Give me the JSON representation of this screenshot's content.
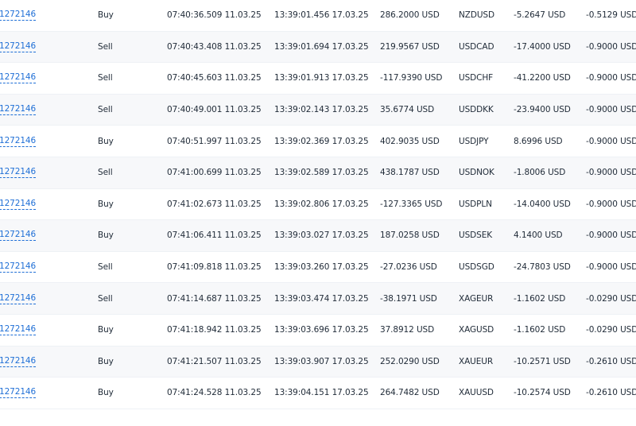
{
  "trades": [
    {
      "id": "1272146",
      "type": "Buy",
      "open_time": "07:40:36.509 11.03.25",
      "close_time": "13:39:01.456 17.03.25",
      "profit": "286.2000 USD",
      "symbol": "NZDUSD",
      "swap": "-5.2647 USD",
      "commission": "-0.5129 USD"
    },
    {
      "id": "1272146",
      "type": "Sell",
      "open_time": "07:40:43.408 11.03.25",
      "close_time": "13:39:01.694 17.03.25",
      "profit": "219.9567 USD",
      "symbol": "USDCAD",
      "swap": "-17.4000 USD",
      "commission": "-0.9000 USD"
    },
    {
      "id": "1272146",
      "type": "Sell",
      "open_time": "07:40:45.603 11.03.25",
      "close_time": "13:39:01.913 17.03.25",
      "profit": "-117.9390 USD",
      "symbol": "USDCHF",
      "swap": "-41.2200 USD",
      "commission": "-0.9000 USD"
    },
    {
      "id": "1272146",
      "type": "Sell",
      "open_time": "07:40:49.001 11.03.25",
      "close_time": "13:39:02.143 17.03.25",
      "profit": "35.6774 USD",
      "symbol": "USDDKK",
      "swap": "-23.9400 USD",
      "commission": "-0.9000 USD"
    },
    {
      "id": "1272146",
      "type": "Buy",
      "open_time": "07:40:51.997 11.03.25",
      "close_time": "13:39:02.369 17.03.25",
      "profit": "402.9035 USD",
      "symbol": "USDJPY",
      "swap": "8.6996 USD",
      "commission": "-0.9000 USD"
    },
    {
      "id": "1272146",
      "type": "Sell",
      "open_time": "07:41:00.699 11.03.25",
      "close_time": "13:39:02.589 17.03.25",
      "profit": "438.1787 USD",
      "symbol": "USDNOK",
      "swap": "-1.8006 USD",
      "commission": "-0.9000 USD"
    },
    {
      "id": "1272146",
      "type": "Buy",
      "open_time": "07:41:02.673 11.03.25",
      "close_time": "13:39:02.806 17.03.25",
      "profit": "-127.3365 USD",
      "symbol": "USDPLN",
      "swap": "-14.0400 USD",
      "commission": "-0.9000 USD"
    },
    {
      "id": "1272146",
      "type": "Buy",
      "open_time": "07:41:06.411 11.03.25",
      "close_time": "13:39:03.027 17.03.25",
      "profit": "187.0258 USD",
      "symbol": "USDSEK",
      "swap": "4.1400 USD",
      "commission": "-0.9000 USD"
    },
    {
      "id": "1272146",
      "type": "Sell",
      "open_time": "07:41:09.818 11.03.25",
      "close_time": "13:39:03.260 17.03.25",
      "profit": "-27.0236 USD",
      "symbol": "USDSGD",
      "swap": "-24.7803 USD",
      "commission": "-0.9000 USD"
    },
    {
      "id": "1272146",
      "type": "Sell",
      "open_time": "07:41:14.687 11.03.25",
      "close_time": "13:39:03.474 17.03.25",
      "profit": "-38.1971 USD",
      "symbol": "XAGEUR",
      "swap": "-1.1602 USD",
      "commission": "-0.0290 USD"
    },
    {
      "id": "1272146",
      "type": "Buy",
      "open_time": "07:41:18.942 11.03.25",
      "close_time": "13:39:03.696 17.03.25",
      "profit": "37.8912 USD",
      "symbol": "XAGUSD",
      "swap": "-1.1602 USD",
      "commission": "-0.0290 USD"
    },
    {
      "id": "1272146",
      "type": "Buy",
      "open_time": "07:41:21.507 11.03.25",
      "close_time": "13:39:03.907 17.03.25",
      "profit": "252.0290 USD",
      "symbol": "XAUEUR",
      "swap": "-10.2571 USD",
      "commission": "-0.2610 USD"
    },
    {
      "id": "1272146",
      "type": "Buy",
      "open_time": "07:41:24.528 11.03.25",
      "close_time": "13:39:04.151 17.03.25",
      "profit": "264.7482 USD",
      "symbol": "XAUUSD",
      "swap": "-10.2574 USD",
      "commission": "-0.2610 USD"
    }
  ],
  "colors": {
    "link": "#1f6fd6",
    "text": "#1f2a37",
    "row_alt": "#f7f8fa"
  }
}
